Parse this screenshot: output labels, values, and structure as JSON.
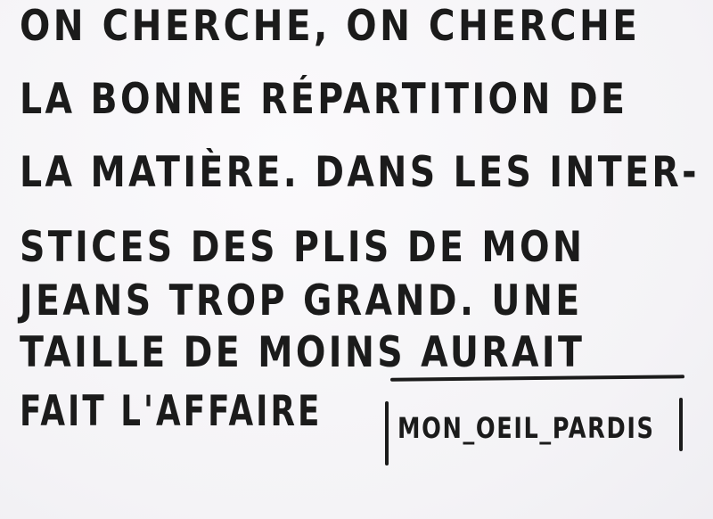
{
  "poem": {
    "lines": [
      "ON CHERCHE, ON CHERCHE",
      "LA BONNE RÉPARTITION DE",
      "LA MATIÈRE. DANS LES INTER-",
      "STICES DES PLIS DE MON",
      "JEANS TROP GRAND. UNE",
      "TAILLE DE MOINS AURAIT",
      "FAIT L'AFFAIRE"
    ]
  },
  "signature": {
    "text": "MON_OEIL_PARDIS"
  }
}
